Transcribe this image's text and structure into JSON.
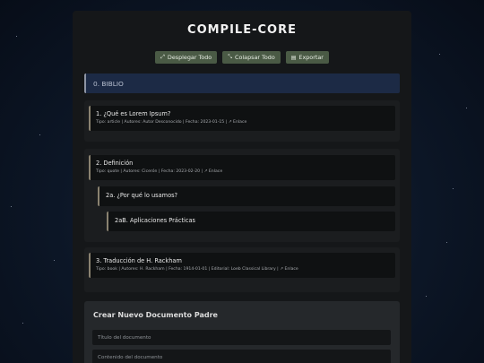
{
  "app": {
    "title": "COMPILE-CORE"
  },
  "toolbar": {
    "expand_all": "Desplegar Todo",
    "collapse_all": "Colapsar Todo",
    "export": "Exportar"
  },
  "biblio": {
    "label": "0. BIBLIO"
  },
  "doc1": {
    "title": "1. ¿Qué es Lorem Ipsum?",
    "meta": "Tipo: article | Autores: Autor Desconocido | Fecha: 2023-01-15 |",
    "link": "Enlace"
  },
  "doc2": {
    "title": "2. Definición",
    "meta": "Tipo: quote | Autores: Cicerón | Fecha: 2023-02-20 |",
    "link": "Enlace",
    "child": {
      "title": "2a. ¿Por qué lo usamos?"
    },
    "grandchild": {
      "title": "2aB. Aplicaciones Prácticas"
    }
  },
  "doc3": {
    "title": "3. Traducción de H. Rackham",
    "meta": "Tipo: book | Autores: H. Rackham | Fecha: 1914-01-01 | Editorial: Loeb Classical Library |",
    "link": "Enlace"
  },
  "new_doc": {
    "heading": "Crear Nuevo Documento Padre",
    "title_placeholder": "Título del documento",
    "content_placeholder": "Contenido del documento"
  }
}
